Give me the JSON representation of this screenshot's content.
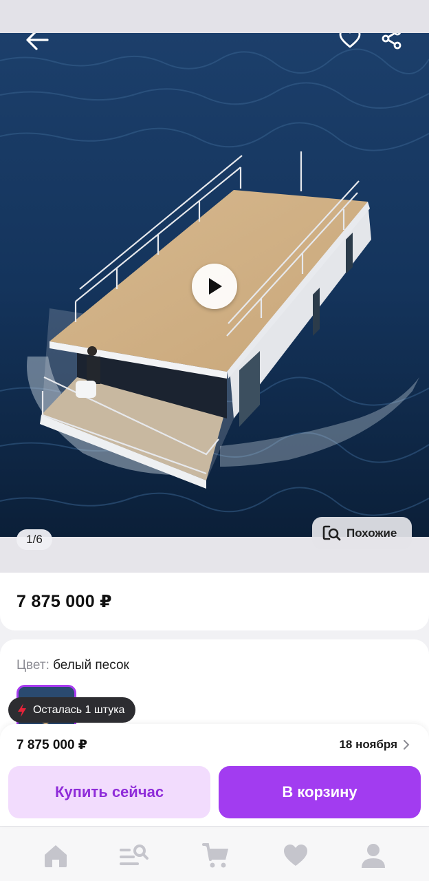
{
  "gallery": {
    "counter": "1/6",
    "similar_label": "Похожие"
  },
  "header": {
    "back_icon": "arrow-left-icon",
    "favorite_icon": "heart-outline-icon",
    "share_icon": "share-icon"
  },
  "product": {
    "price": "7 875 000 ₽"
  },
  "color": {
    "label": "Цвет:",
    "value": "белый песок"
  },
  "stock": {
    "text": "Осталась 1 штука",
    "accent": "#e8233a"
  },
  "purchase": {
    "price": "7 875 000 ₽",
    "delivery_date": "18 ноября",
    "buy_now_label": "Купить сейчас",
    "add_to_cart_label": "В корзину",
    "accent": "#a23cf0"
  },
  "bottom_nav": {
    "items": [
      "home-icon",
      "catalog-search-icon",
      "cart-icon",
      "favorites-icon",
      "profile-icon"
    ]
  }
}
